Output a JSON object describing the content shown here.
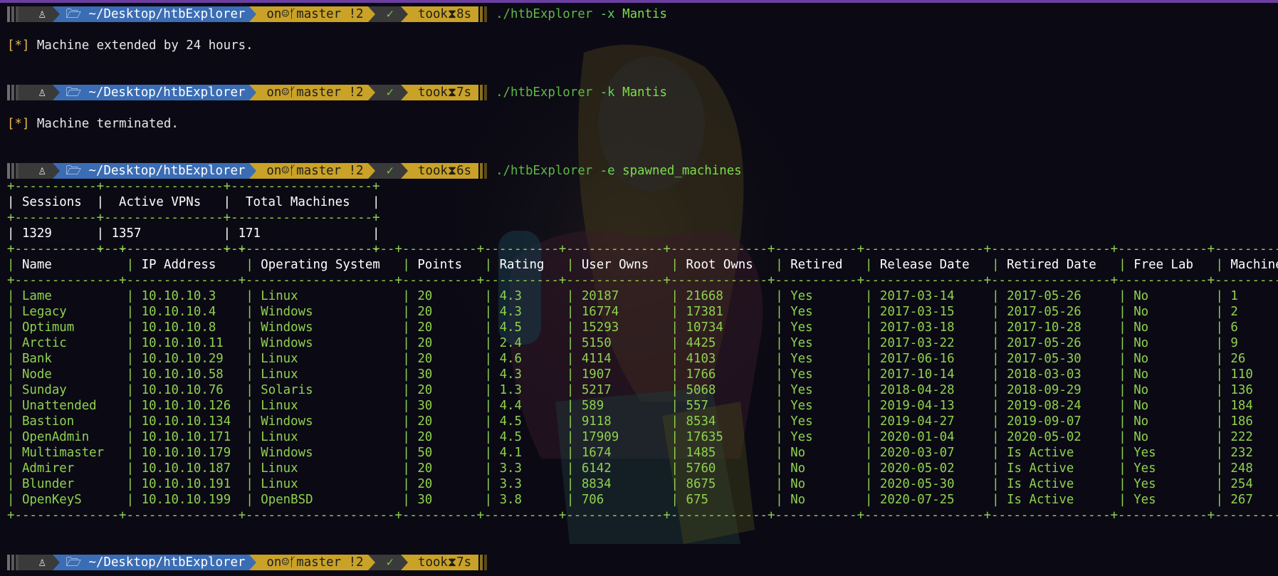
{
  "prompt": {
    "os_icon": "linux-tux-icon",
    "dir_icon": "folder-icon",
    "dir": "~/Desktop/htbExplorer",
    "git_on": "on",
    "git_icons": "github-icon branch-icon",
    "branch": "master !2",
    "check": "✓",
    "took_label": "took",
    "hourglass": "⧗"
  },
  "blocks": [
    {
      "cmd_exe": "./htbExplorer",
      "cmd_flag": "-x",
      "cmd_arg": "Mantis",
      "took": "8s",
      "output": "Machine extended by 24 hours."
    },
    {
      "cmd_exe": "./htbExplorer",
      "cmd_flag": "-k",
      "cmd_arg": "Mantis",
      "took": "7s",
      "output": "Machine terminated."
    },
    {
      "cmd_exe": "./htbExplorer",
      "cmd_flag": "-e",
      "cmd_arg": "spawned_machines",
      "took": "6s"
    },
    {
      "took": "7s"
    }
  ],
  "output_marker": "[*]",
  "summary_table": {
    "border": "+-----------+----------------+-------------------+",
    "header": "| Sessions  |  Active VPNs   |  Total Machines   |",
    "row": "| 1329      | 1357           | 171               |"
  },
  "machines_table": {
    "columns": [
      "Name",
      "IP Address",
      "Operating System",
      "Points",
      "Rating",
      "User Owns",
      "Root Owns",
      "Retired",
      "Release Date",
      "Retired Date",
      "Free Lab",
      "Machine ID"
    ],
    "rows": [
      [
        "Lame",
        "10.10.10.3",
        "Linux",
        "20",
        "4.3",
        "20187",
        "21668",
        "Yes",
        "2017-03-14",
        "2017-05-26",
        "No",
        "1"
      ],
      [
        "Legacy",
        "10.10.10.4",
        "Windows",
        "20",
        "4.3",
        "16774",
        "17381",
        "Yes",
        "2017-03-15",
        "2017-05-26",
        "No",
        "2"
      ],
      [
        "Optimum",
        "10.10.10.8",
        "Windows",
        "20",
        "4.5",
        "15293",
        "10734",
        "Yes",
        "2017-03-18",
        "2017-10-28",
        "No",
        "6"
      ],
      [
        "Arctic",
        "10.10.10.11",
        "Windows",
        "20",
        "2.4",
        "5150",
        "4425",
        "Yes",
        "2017-03-22",
        "2017-05-26",
        "No",
        "9"
      ],
      [
        "Bank",
        "10.10.10.29",
        "Linux",
        "20",
        "4.6",
        "4114",
        "4103",
        "Yes",
        "2017-06-16",
        "2017-05-30",
        "No",
        "26"
      ],
      [
        "Node",
        "10.10.10.58",
        "Linux",
        "30",
        "4.3",
        "1907",
        "1766",
        "Yes",
        "2017-10-14",
        "2018-03-03",
        "No",
        "110"
      ],
      [
        "Sunday",
        "10.10.10.76",
        "Solaris",
        "20",
        "1.3",
        "5217",
        "5068",
        "Yes",
        "2018-04-28",
        "2018-09-29",
        "No",
        "136"
      ],
      [
        "Unattended",
        "10.10.10.126",
        "Linux",
        "30",
        "4.4",
        "589",
        "557",
        "Yes",
        "2019-04-13",
        "2019-08-24",
        "No",
        "184"
      ],
      [
        "Bastion",
        "10.10.10.134",
        "Windows",
        "20",
        "4.5",
        "9118",
        "8534",
        "Yes",
        "2019-04-27",
        "2019-09-07",
        "No",
        "186"
      ],
      [
        "OpenAdmin",
        "10.10.10.171",
        "Linux",
        "20",
        "4.5",
        "17909",
        "17635",
        "Yes",
        "2020-01-04",
        "2020-05-02",
        "No",
        "222"
      ],
      [
        "Multimaster",
        "10.10.10.179",
        "Windows",
        "50",
        "4.1",
        "1674",
        "1485",
        "No",
        "2020-03-07",
        "Is Active",
        "Yes",
        "232"
      ],
      [
        "Admirer",
        "10.10.10.187",
        "Linux",
        "20",
        "3.3",
        "6142",
        "5760",
        "No",
        "2020-05-02",
        "Is Active",
        "Yes",
        "248"
      ],
      [
        "Blunder",
        "10.10.10.191",
        "Linux",
        "20",
        "3.3",
        "8834",
        "8675",
        "No",
        "2020-05-30",
        "Is Active",
        "Yes",
        "254"
      ],
      [
        "OpenKeyS",
        "10.10.10.199",
        "OpenBSD",
        "30",
        "3.8",
        "706",
        "675",
        "No",
        "2020-07-25",
        "Is Active",
        "Yes",
        "267"
      ]
    ]
  },
  "colors": {
    "background": "#0b0a14",
    "prompt_dir": "#3b6db4",
    "prompt_git": "#c9a227",
    "prompt_dark": "#3a3a3a",
    "command": "#5fb845",
    "table_green": "#8fd14f",
    "marker": "#e8b84a",
    "window_border": "#6b3fa0"
  }
}
